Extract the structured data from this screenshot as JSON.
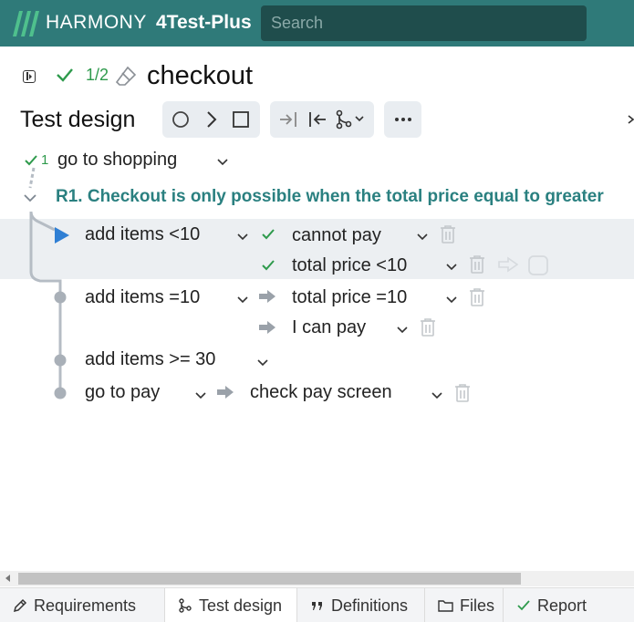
{
  "header": {
    "brand": "HARMONY",
    "project": "4Test-Plus",
    "search_placeholder": "Search",
    "logo_icon": "harmony-logo-icon",
    "background": "#2f7a79"
  },
  "title_bar": {
    "status_count": "1/2",
    "title": "checkout"
  },
  "toolbar": {
    "section_title": "Test design"
  },
  "tree": {
    "steps": [
      {
        "number": "1",
        "label": "go to shopping"
      }
    ],
    "rule_title": "R1. Checkout is only possible when the total price equal to greater",
    "rows": [
      {
        "action": "add items <10",
        "results": [
          "cannot pay",
          "total price <10"
        ]
      },
      {
        "action": "add items =10",
        "results": [
          "total price =10",
          "I can pay"
        ]
      },
      {
        "action": "add items >= 30",
        "results": []
      },
      {
        "action": "go to pay",
        "results": [
          "check pay screen"
        ]
      }
    ],
    "colors": {
      "accent": "#2a8080",
      "check": "#2e9a4c",
      "play": "#2f7fd4"
    }
  },
  "bottom_tabs": [
    {
      "label": "Requirements",
      "icon": "pencil-icon"
    },
    {
      "label": "Test design",
      "icon": "branch-icon",
      "active": true
    },
    {
      "label": "Definitions",
      "icon": "quote-icon"
    },
    {
      "label": "Files",
      "icon": "folder-icon"
    },
    {
      "label": "Report",
      "icon": "check-icon"
    }
  ]
}
